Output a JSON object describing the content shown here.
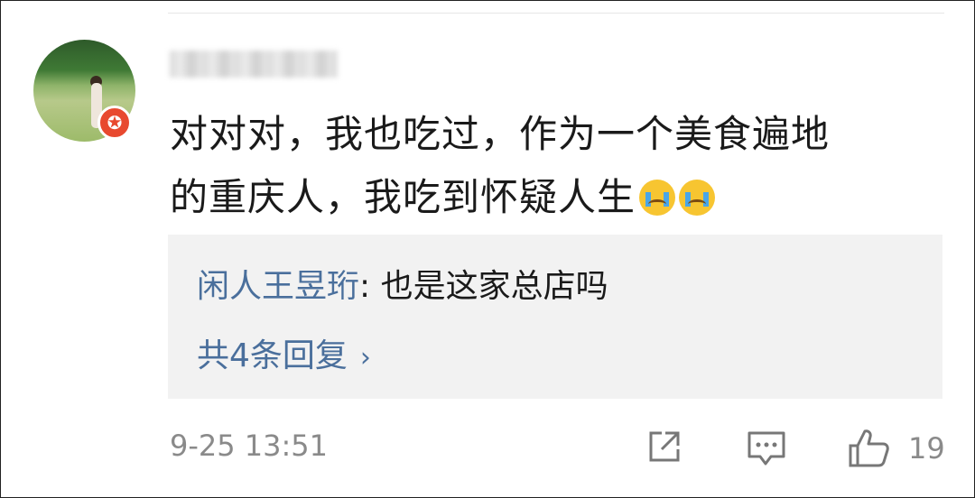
{
  "comment": {
    "username": "",
    "line1": "对对对，我也吃过，作为一个美食遍地",
    "line2": "的重庆人，我吃到怀疑人生",
    "emojis": [
      "crying-face",
      "crying-face"
    ]
  },
  "reply_preview": {
    "user": "闲人王昱珩",
    "separator": ": ",
    "text": "也是这家总店吗",
    "more_label": "共4条回复",
    "more_chevron": "›"
  },
  "footer": {
    "timestamp": "9-25 13:51",
    "like_count": "19",
    "icons": [
      "share-icon",
      "comment-icon",
      "thumbs-up-icon"
    ]
  },
  "badge": {
    "glyph": "✪",
    "color": "#e8492f"
  },
  "colors": {
    "link": "#4a6f9c",
    "text": "#1a1a1a",
    "muted": "#8a8a8a",
    "reply_bg": "#f2f2f2"
  }
}
